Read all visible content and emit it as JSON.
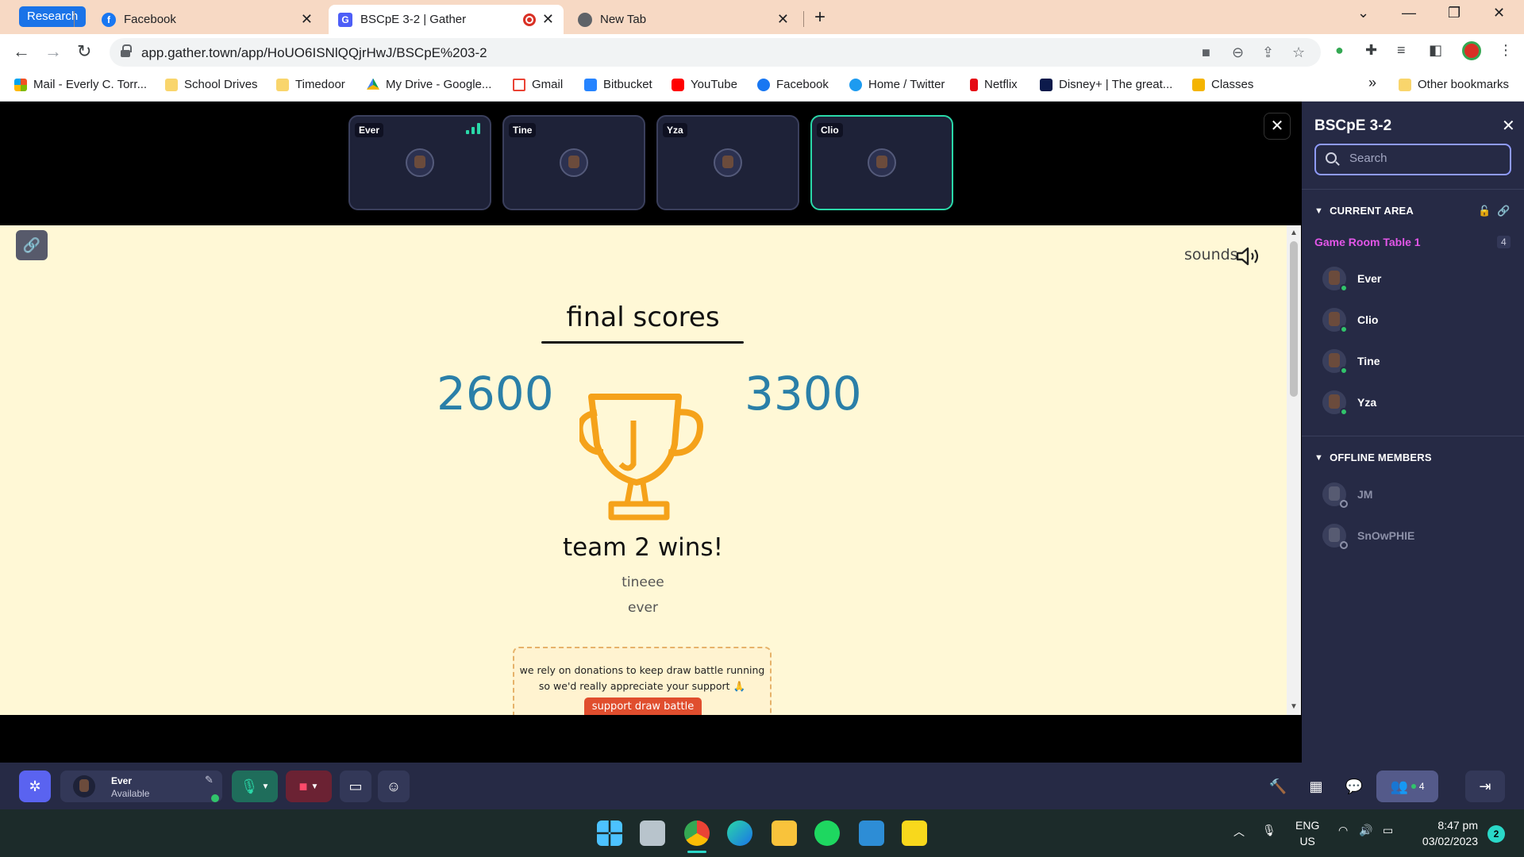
{
  "browser": {
    "research_label": "Research",
    "tabs": [
      {
        "label": "Facebook",
        "icon": "facebook-icon"
      },
      {
        "label": "BSCpE 3-2 | Gather",
        "icon": "gather-icon",
        "active": true
      },
      {
        "label": "New Tab",
        "icon": "chrome-icon"
      }
    ],
    "new_tab": "+",
    "url": "app.gather.town/app/HoUO6ISNlQQjrHwJ/BSCpE%203-2",
    "bookmarks": [
      "Mail - Everly C. Torr...",
      "School Drives",
      "Timedoor",
      "My Drive - Google...",
      "Gmail",
      "Bitbucket",
      "YouTube",
      "Facebook",
      "Home / Twitter",
      "Netflix",
      "Disney+ | The great...",
      "Classes"
    ],
    "more_bookmarks": "»",
    "other_bookmarks": "Other bookmarks"
  },
  "video": {
    "tiles": [
      {
        "name": "Ever",
        "signal": true
      },
      {
        "name": "Tine"
      },
      {
        "name": "Yza"
      },
      {
        "name": "Clio",
        "speaking": true
      }
    ]
  },
  "game": {
    "sounds_label": "sounds",
    "title": "final scores",
    "team1_score": "2600",
    "team2_score": "3300",
    "winner": "team 2 wins!",
    "winners": [
      "tineee",
      "ever"
    ],
    "donate_line1": "we rely on donations to keep draw battle running",
    "donate_line2": "so we'd really appreciate your support 🙏",
    "donate_button": "support draw battle"
  },
  "panel": {
    "title": "BSCpE 3-2",
    "search_placeholder": "Search",
    "current_area_label": "CURRENT AREA",
    "area_name": "Game Room Table 1",
    "area_count": "4",
    "online": [
      "Ever",
      "Clio",
      "Tine",
      "Yza"
    ],
    "offline_label": "OFFLINE MEMBERS",
    "offline": [
      "JM",
      "SnOwPHIE"
    ]
  },
  "bottom_bar": {
    "me_name": "Ever",
    "me_status": "Available",
    "participants_count": "4"
  },
  "taskbar": {
    "lang1": "ENG",
    "lang2": "US",
    "time": "8:47 pm",
    "date": "03/02/2023",
    "notifications": "2"
  },
  "colors": {
    "accent": "#2ad8a8",
    "score": "#2a7fa8",
    "trophy": "#f5a21a",
    "area": "#e356e8",
    "panel_bg": "#262a45"
  }
}
